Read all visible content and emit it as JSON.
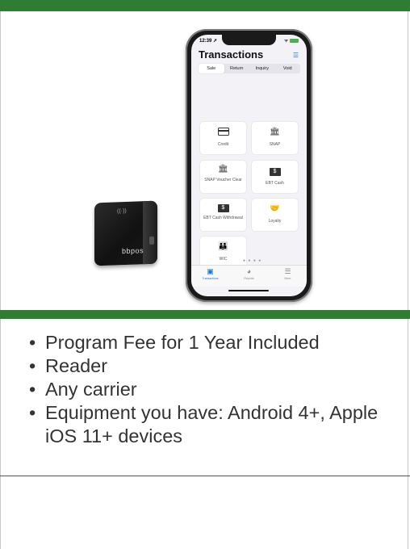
{
  "phone": {
    "status_time": "12:39 ➚",
    "status_icons": "ᯤ",
    "title": "Transactions",
    "tabs": [
      "Sale",
      "Return",
      "Inquiry",
      "Void"
    ],
    "active_tab": "Sale",
    "tiles": [
      {
        "label": "Credit",
        "icon": "credit-card-icon"
      },
      {
        "label": "SNAP",
        "icon": "bank-icon"
      },
      {
        "label": "SNAP Voucher Clear",
        "icon": "bank-icon"
      },
      {
        "label": "EBT Cash",
        "icon": "dollar-icon"
      },
      {
        "label": "EBT Cash Withdrawal",
        "icon": "dollar-icon"
      },
      {
        "label": "Loyalty",
        "icon": "handshake-icon"
      },
      {
        "label": "WIC",
        "icon": "family-icon"
      }
    ],
    "tabbar": [
      {
        "label": "Transactions",
        "icon": "transactions-icon",
        "active": true
      },
      {
        "label": "Reports",
        "icon": "pie-chart-icon",
        "active": false
      },
      {
        "label": "More",
        "icon": "menu-icon",
        "active": false
      }
    ]
  },
  "reader": {
    "nfc_mark": "((·))",
    "logo": "bbpos"
  },
  "features": [
    "Program Fee for 1 Year Included",
    "Reader",
    "Any carrier",
    "Equipment you have: Android 4+, Apple iOS 11+ devices"
  ],
  "colors": {
    "accent_green": "#2e7d32",
    "ios_blue": "#1a73e8"
  }
}
